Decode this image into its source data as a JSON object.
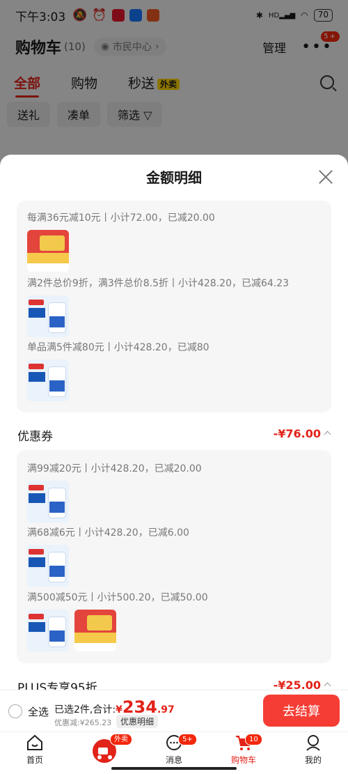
{
  "status_bar": {
    "time": "下午3:03",
    "battery": "70",
    "network": "HD"
  },
  "header": {
    "title": "购物车",
    "count": "(10)",
    "location": "市民中心",
    "manage": "管理",
    "more_badge": "5+"
  },
  "tabs": {
    "all": "全部",
    "shop": "购物",
    "flash": "秒送",
    "flash_tag": "外卖"
  },
  "chips": [
    "送礼",
    "凑单",
    "筛选"
  ],
  "sheet": {
    "title": "金额明细",
    "promo_rules": [
      "每满36元减10元丨小计72.00，已减20.00",
      "满2件总价9折，满3件总价8.5折丨小计428.20，已减64.23",
      "单品满5件减80元丨小计428.20，已减80"
    ],
    "coupon": {
      "label": "优惠券",
      "value": "-¥76.00",
      "rules": [
        "满99减20元丨小计428.20，已减20.00",
        "满68减6元丨小计428.20，已减6.00",
        "满500减50元丨小计500.20，已减50.00"
      ]
    },
    "plus": {
      "label": "PLUS专享95折",
      "value": "-¥25.00"
    }
  },
  "checkout": {
    "select_all": "全选",
    "selected_text": "已选2件,合计:",
    "currency": "¥",
    "total_int": "234",
    "total_dec": ".97",
    "discount": "优惠减:¥265.23",
    "detail_btn": "优惠明细",
    "submit": "去结算"
  },
  "tabbar": {
    "home": "首页",
    "waimai_badge": "外卖",
    "messages": "消息",
    "messages_badge": "5+",
    "cart": "购物车",
    "cart_badge": "10",
    "me": "我的"
  },
  "colors": {
    "accent": "#e2231a",
    "button": "#f53d35"
  }
}
